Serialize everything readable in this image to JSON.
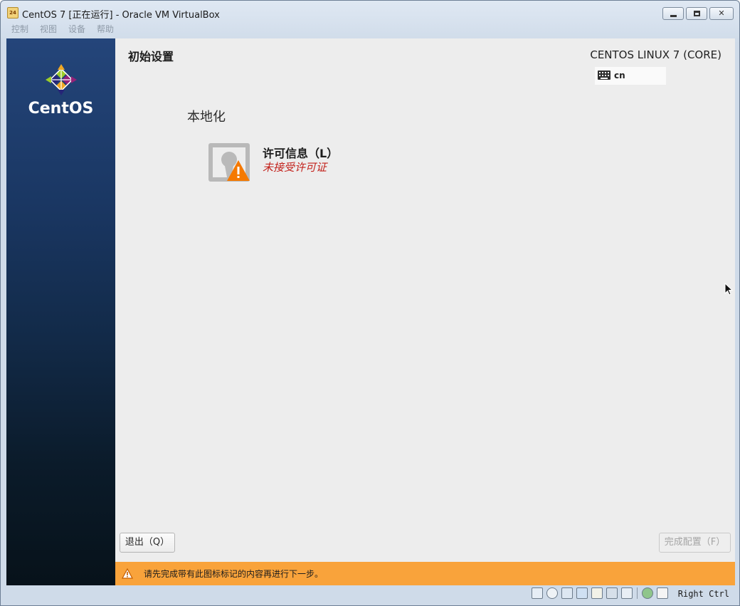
{
  "window": {
    "title": "CentOS 7 [正在运行] - Oracle VM VirtualBox",
    "icon_label": "24",
    "buttons": [
      "minimize",
      "maximize",
      "close"
    ]
  },
  "menubar": {
    "items": [
      "控制",
      "视图",
      "设备",
      "帮助"
    ]
  },
  "sidebar": {
    "logo_text": "CentOS"
  },
  "header": {
    "title": "初始设置",
    "distribution": "CENTOS LINUX 7 (CORE)",
    "keyboard_layout": "cn"
  },
  "main": {
    "section_title": "本地化",
    "spokes": [
      {
        "name": "许可信息（L）",
        "status": "未接受许可证",
        "icon": "license-warning-icon",
        "status_color": "#c3221c"
      }
    ]
  },
  "buttons": {
    "quit": "退出（Q）",
    "finish": "完成配置（F）"
  },
  "warning_bar": {
    "text": "请先完成带有此图标标记的内容再进行下一步。",
    "color": "#f9a33b"
  },
  "statusbar": {
    "icons": [
      "hard-disk-icon",
      "optical-disk-icon",
      "usb-icon",
      "network-icon",
      "shared-folder-icon",
      "video-capture-icon",
      "recording-icon",
      "virtualization-icon",
      "mouse-integration-icon"
    ],
    "host_key": "Right Ctrl"
  }
}
